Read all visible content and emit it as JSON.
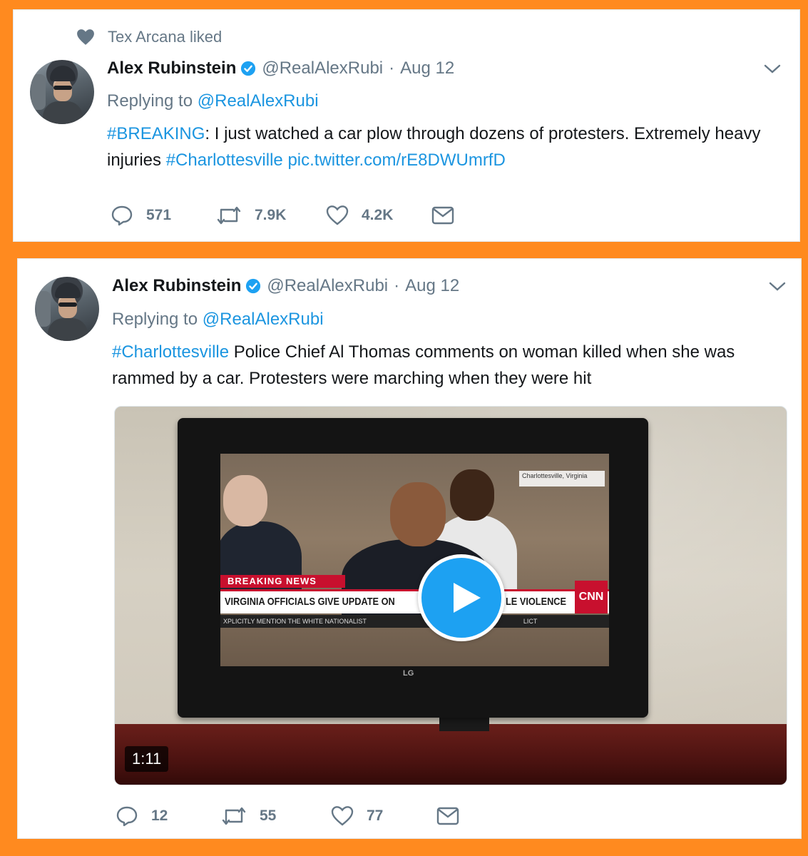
{
  "colors": {
    "background": "#ff8a1f",
    "link": "#1b95e0",
    "muted": "#657786",
    "verified": "#1da1f2",
    "play_button": "#1da1f2"
  },
  "tweets": [
    {
      "social_context": "Tex Arcana liked",
      "author": "Alex Rubinstein",
      "handle": "@RealAlexRubi",
      "separator": "·",
      "date": "Aug 12",
      "replying_prefix": "Replying to",
      "replying_handle": "@RealAlexRubi",
      "hashtag_lead": "#BREAKING",
      "text_part1": ": I just watched a car plow through dozens of protesters. Extremely heavy injuries ",
      "hashtag_tail": "#Charlottesville",
      "pic_link": " pic.twitter.com/rE8DWUmrfD",
      "replies": "571",
      "retweets": "7.9K",
      "likes": "4.2K"
    },
    {
      "author": "Alex Rubinstein",
      "handle": "@RealAlexRubi",
      "separator": "·",
      "date": "Aug 12",
      "replying_prefix": "Replying to",
      "replying_handle": "@RealAlexRubi",
      "hashtag_lead": "#Charlottesville",
      "text_part1": " Police Chief Al Thomas comments on woman killed when she was rammed by a car. Protesters were marching when they were hit",
      "video": {
        "duration": "1:11",
        "tv_breaking": "BREAKING NEWS",
        "tv_headline_left": "VIRGINIA OFFICIALS GIVE UPDATE ON",
        "tv_headline_right": "LE VIOLENCE",
        "tv_ticker": "XPLICITLY MENTION THE WHITE NATIONALIST",
        "tv_ticker_right": "LICT",
        "tv_network": "CNN",
        "tv_location": "Charlottesville, Virginia",
        "tv_brand": "LG"
      },
      "replies": "12",
      "retweets": "55",
      "likes": "77"
    }
  ]
}
